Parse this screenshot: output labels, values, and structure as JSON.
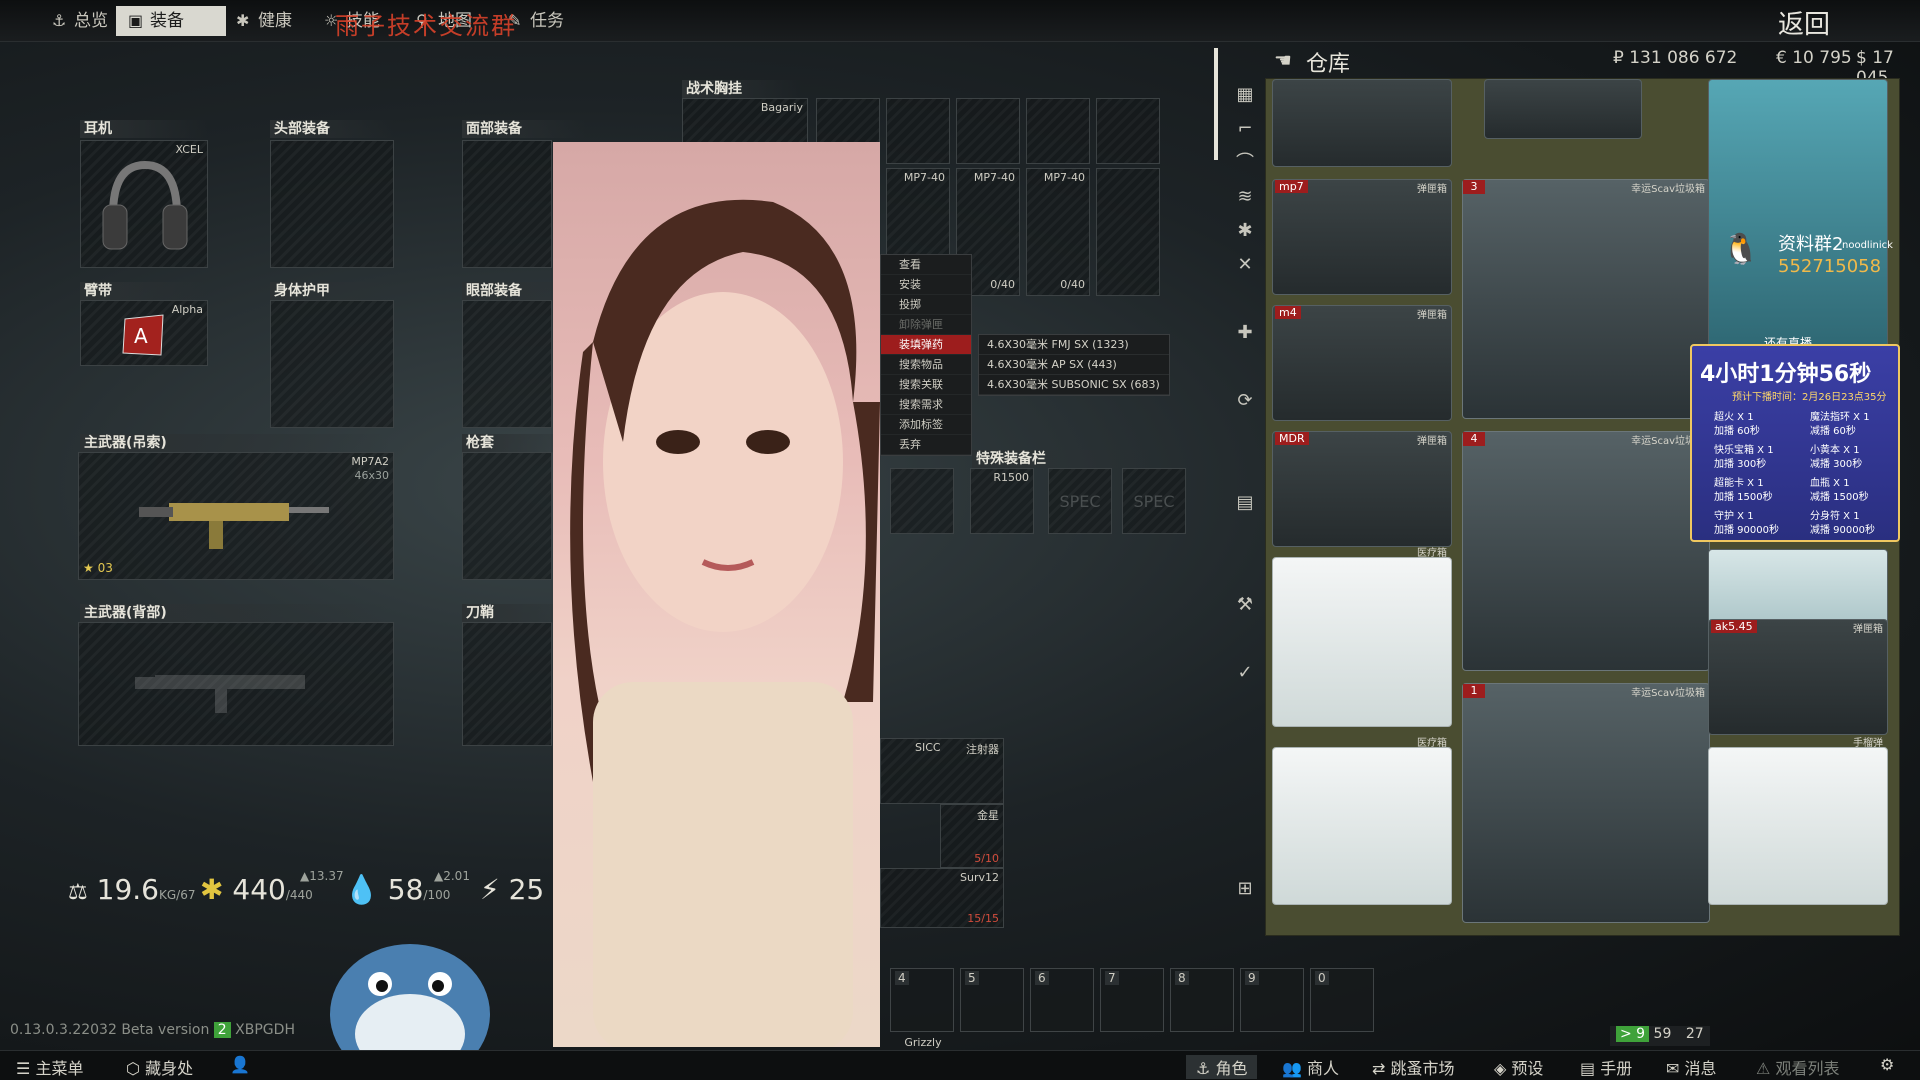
{
  "topbar": {
    "tabs": [
      {
        "label": "总览",
        "icon": "anchor-icon"
      },
      {
        "label": "装备",
        "icon": "vest-icon"
      },
      {
        "label": "健康",
        "icon": "health-icon"
      },
      {
        "label": "技能",
        "icon": "skills-icon"
      },
      {
        "label": "地图",
        "icon": "map-pin-icon"
      },
      {
        "label": "任务",
        "icon": "quest-icon"
      }
    ],
    "overlay_title": "雨子技术交流群",
    "back_label": "返回"
  },
  "gear": {
    "earpiece": {
      "label": "耳机",
      "item": "XCEL"
    },
    "headwear": {
      "label": "头部装备"
    },
    "facecover": {
      "label": "面部装备"
    },
    "armband": {
      "label": "臂带",
      "item": "Alpha"
    },
    "armor": {
      "label": "身体护甲"
    },
    "eyewear": {
      "label": "眼部装备"
    },
    "primary_sling": {
      "label": "主武器(吊索)",
      "item": "MP7A2",
      "caliber": "46x30",
      "level": "03"
    },
    "holster": {
      "label": "枪套"
    },
    "primary_back": {
      "label": "主武器(背部)"
    },
    "scabbard": {
      "label": "刀鞘"
    },
    "rig": {
      "label": "战术胸挂",
      "item": "Bagariy"
    }
  },
  "rig_mags": [
    {
      "name": "MP7-40",
      "count": ""
    },
    {
      "name": "MP7-40",
      "count": "0/40"
    },
    {
      "name": "MP7-40",
      "count": "0/40"
    }
  ],
  "context_menu": {
    "items": [
      "查看",
      "安装",
      "投掷",
      "卸除弹匣",
      "装填弹药",
      "搜索物品",
      "搜索关联",
      "搜索需求",
      "添加标签",
      "丢弃"
    ],
    "highlighted": "装填弹药"
  },
  "ammo_menu": [
    "4.6X30毫米 FMJ SX (1323)",
    "4.6X30毫米 AP SX (443)",
    "4.6X30毫米 SUBSONIC SX (683)"
  ],
  "special": {
    "label": "特殊装备栏",
    "item": "R1500",
    "spec": "SPEC"
  },
  "pockets": [
    {
      "name": "SICC",
      "tag": "注射器"
    },
    {
      "name": "金星",
      "count": "5/10"
    },
    {
      "name": "Surv12",
      "count": "15/15"
    }
  ],
  "stats": {
    "weight": "19.6",
    "weight_unit": "KG",
    "weight_max": "67",
    "health": "440",
    "health_max": "/440",
    "health_up": "▲13.37",
    "hydration": "58",
    "hydration_max": "/100",
    "hydration_up": "▲2.01",
    "energy": "25"
  },
  "hotbar": [
    {
      "key": "4",
      "item": "Grizzly"
    },
    {
      "key": "5"
    },
    {
      "key": "6"
    },
    {
      "key": "7"
    },
    {
      "key": "8"
    },
    {
      "key": "9"
    },
    {
      "key": "0"
    }
  ],
  "version": "0.13.0.3.22032 Beta version",
  "version_id": "XBPGDH",
  "version_badge": "2",
  "stash": {
    "title": "仓库",
    "currency_rub": "₽ 131 086 672",
    "currency_eur": "€ 10 795",
    "currency_usd": "$ 17 045",
    "cases": [
      {
        "name": "mp7",
        "tag": "弹匣箱"
      },
      {
        "name": "m4",
        "tag": "弹匣箱"
      },
      {
        "name": "MDR",
        "tag": "弹匣箱"
      },
      {
        "name": "",
        "tag": "医疗箱"
      },
      {
        "name": "",
        "tag": "医疗箱"
      },
      {
        "name": "ak5.45",
        "tag": "弹匣箱"
      },
      {
        "name": "",
        "tag": "手榴弹"
      }
    ],
    "big_cases": [
      {
        "num": "3",
        "tag": "幸运Scav垃圾箱"
      },
      {
        "num": "4",
        "tag": "幸运Scav垃圾箱"
      },
      {
        "num": "1",
        "tag": "幸运Scav垃圾箱"
      }
    ]
  },
  "qq_overlay": {
    "group": "资料群2",
    "number": "552715058",
    "user": "noodlinick",
    "note": "还有直播"
  },
  "promo": {
    "timer": "4小时1分钟56秒",
    "subtitle": "预计下播时间：2月26日23点35分",
    "rows": [
      [
        "超火 X 1",
        "加播 60秒"
      ],
      [
        "快乐宝箱 X 1",
        "加播 300秒"
      ],
      [
        "超能卡 X 1",
        "加播 1500秒"
      ],
      [
        "守护 X 1",
        "加播 90000秒"
      ],
      [
        "魔法指环 X 1",
        "减播 60秒"
      ],
      [
        "小黄本 X 1",
        "减播 300秒"
      ],
      [
        "血瓶 X 1",
        "减播 1500秒"
      ],
      [
        "分身符 X 1",
        "减播 90000秒"
      ]
    ]
  },
  "bottombar": {
    "left": [
      "主菜单",
      "藏身处"
    ],
    "right": [
      "角色",
      "商人",
      "跳蚤市场",
      "预设",
      "手册",
      "消息",
      "观看列表"
    ]
  },
  "status_right": {
    "fps": "> 9",
    "time": "59",
    "players": "27"
  }
}
